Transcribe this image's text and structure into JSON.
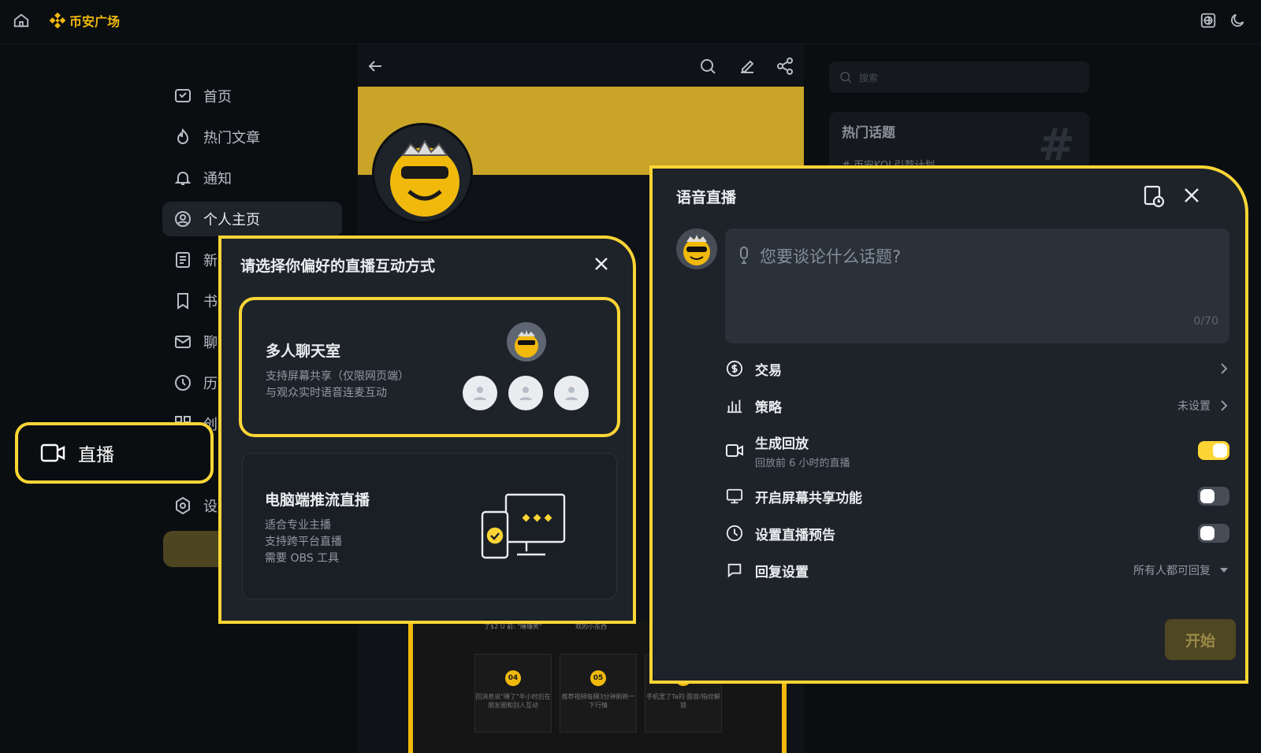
{
  "brand": {
    "name": "币安广场"
  },
  "nav": {
    "items": [
      {
        "label": "首页",
        "icon": "home-feed-icon"
      },
      {
        "label": "热门文章",
        "icon": "fire-icon"
      },
      {
        "label": "通知",
        "icon": "bell-icon"
      },
      {
        "label": "个人主页",
        "icon": "user-circle-icon",
        "active": true
      },
      {
        "label": "新",
        "icon": "document-icon"
      },
      {
        "label": "书",
        "icon": "bookmark-icon"
      },
      {
        "label": "聊",
        "icon": "mail-icon"
      },
      {
        "label": "历",
        "icon": "clock-icon"
      },
      {
        "label": "创",
        "icon": "grid-icon"
      },
      {
        "label": "设",
        "icon": "settings-icon"
      }
    ],
    "live_label": "直播"
  },
  "right": {
    "search_placeholder": "搜索",
    "hot_title": "热门话题",
    "hot_item": "# 币安KOL引荐计划"
  },
  "background_cards": [
    {
      "num": "04",
      "text": "回消息说\"睡了\"半小时后在朋友圈和别人互动"
    },
    {
      "num": "05",
      "text": "推荐视频每隔3分钟刷新一下行情"
    },
    {
      "num": "06",
      "text": "手机里了Ta的·面容/指纹解锁"
    }
  ],
  "background_snippets": [
    "了$2 U 前: \"睡爆笑\"",
    "欢的小东西"
  ],
  "mode_modal": {
    "title": "请选择你偏好的直播互动方式",
    "options": [
      {
        "title": "多人聊天室",
        "desc": [
          "支持屏幕共享（仅限网页端）",
          "与观众实时语音连麦互动"
        ]
      },
      {
        "title": "电脑端推流直播",
        "desc": [
          "适合专业主播",
          "支持跨平台直播",
          "需要 OBS 工具"
        ]
      }
    ]
  },
  "voice_panel": {
    "title": "语音直播",
    "placeholder": "您要谈论什么话题?",
    "counter": "0/70",
    "settings": [
      {
        "label": "交易",
        "icon": "dollar-circle-icon",
        "right_text": ""
      },
      {
        "label": "策略",
        "icon": "bar-chart-icon",
        "right_text": "未设置"
      },
      {
        "label": "生成回放",
        "sub": "回放前 6 小时的直播",
        "icon": "video-icon",
        "toggle": true
      },
      {
        "label": "开启屏幕共享功能",
        "icon": "monitor-icon",
        "toggle": false
      },
      {
        "label": "设置直播预告",
        "icon": "clock-icon",
        "toggle": false
      },
      {
        "label": "回复设置",
        "icon": "chat-bubble-icon",
        "right_text": "所有人都可回复"
      }
    ],
    "start_label": "开始"
  },
  "colors": {
    "accent": "#FCD535",
    "brand": "#F0B90B",
    "bg": "#0B0E11",
    "panel": "#1E2329"
  }
}
